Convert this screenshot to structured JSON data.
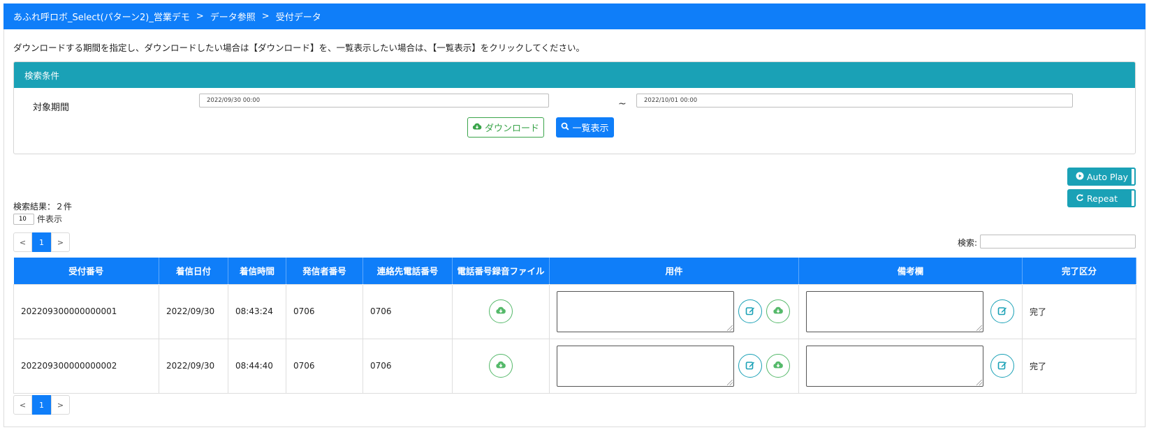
{
  "breadcrumb": [
    "あふれ呼ロボ_Select(パターン2)_営業デモ",
    "データ参照",
    "受付データ"
  ],
  "breadcrumb_sep": ">",
  "instruction": "ダウンロードする期間を指定し、ダウンロードしたい場合は【ダウンロード】を、一覧表示したい場合は、【一覧表示】をクリックしてください。",
  "search_panel": {
    "title": "検索条件",
    "period_label": "対象期間",
    "start_value": "2022/09/30 00:00",
    "tilde": "~",
    "end_value": "2022/10/01 00:00",
    "download_label": "ダウンロード",
    "list_label": "一覧表示"
  },
  "auto_play_label": "Auto Play",
  "repeat_label": "Repeat",
  "result_count": "検索結果：２件",
  "per_page_value": "10",
  "per_page_label": "件表示",
  "pager": {
    "prev": "<",
    "page": "1",
    "next": ">"
  },
  "search_label": "検索:",
  "table": {
    "headers": [
      "受付番号",
      "着信日付",
      "着信時間",
      "発信者番号",
      "連絡先電話番号",
      "電話番号録音ファイル",
      "用件",
      "備考欄",
      "完了区分"
    ],
    "rows": [
      {
        "id": "202209300000000001",
        "date": "2022/09/30",
        "time": "08:43:24",
        "caller": "0706",
        "contact": "0706",
        "status": "完了"
      },
      {
        "id": "202209300000000002",
        "date": "2022/09/30",
        "time": "08:44:40",
        "caller": "0706",
        "contact": "0706",
        "status": "完了"
      }
    ]
  },
  "colors": {
    "header_blue": "#0f7ef9",
    "panel_teal": "#1aa1b6",
    "download_green": "#3aa44a"
  },
  "icons": [
    "cloud-download-icon",
    "search-icon",
    "play-circle-icon",
    "redo-icon",
    "edit-icon"
  ]
}
